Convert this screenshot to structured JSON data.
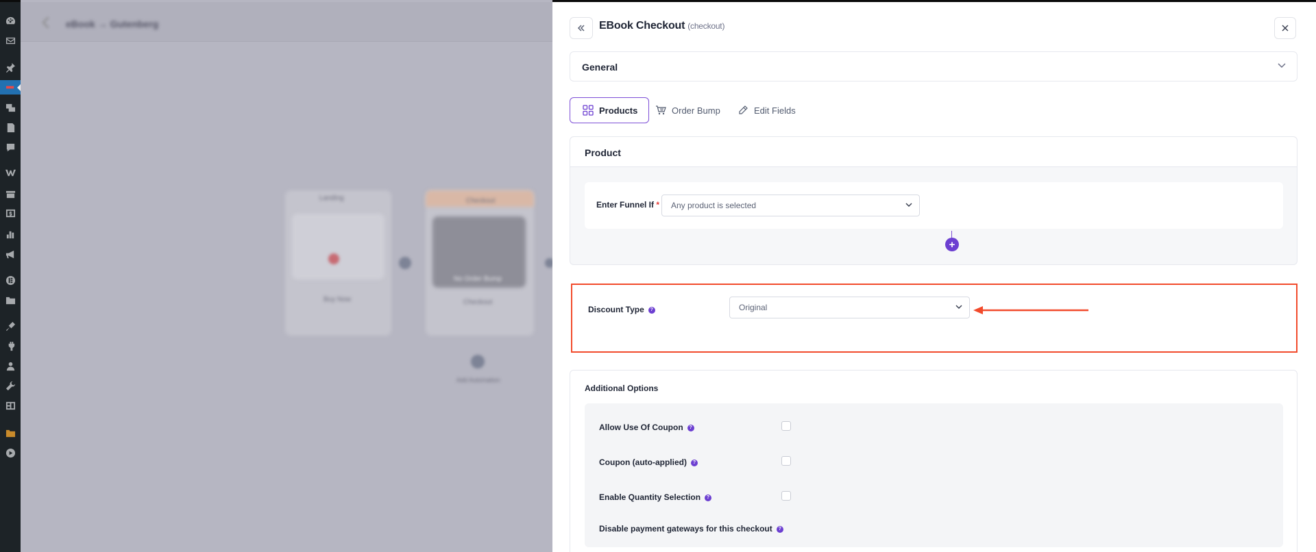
{
  "canvas": {
    "breadcrumb": "eBook → Gutenberg",
    "nodes": [
      {
        "label": "Landing",
        "caption": "Buy Now"
      },
      {
        "label": "Checkout",
        "caption": "Checkout",
        "banner": "No Order Bump"
      }
    ],
    "bottom_node_caption": "Add Automation"
  },
  "drawer": {
    "title": "EBook Checkout",
    "subtitle": "(checkout)",
    "general_label": "General",
    "tabs": [
      {
        "label": "Products",
        "icon": "grid-icon",
        "active": true
      },
      {
        "label": "Order Bump",
        "icon": "cart-icon",
        "active": false
      },
      {
        "label": "Edit Fields",
        "icon": "pencil-icon",
        "active": false
      }
    ],
    "product": {
      "heading": "Product",
      "enter_funnel_label": "Enter Funnel If",
      "required_mark": "*",
      "condition_value": "Any product is selected",
      "add_glyph": "+"
    },
    "discount": {
      "label": "Discount Type",
      "value": "Original"
    },
    "additional": {
      "heading": "Additional Options",
      "options": [
        {
          "label": "Allow Use Of Coupon",
          "checked": false
        },
        {
          "label": "Coupon (auto-applied)",
          "checked": false
        },
        {
          "label": "Enable Quantity Selection",
          "checked": false
        },
        {
          "label": "Disable payment gateways for this checkout"
        }
      ]
    },
    "help_glyph": "?"
  },
  "colors": {
    "accent": "#6c3fd1",
    "highlight": "#f24a2b",
    "wp_sidebar": "#1d2327",
    "wp_active": "#2271b1"
  },
  "sidebar_icons": [
    "dashboard-icon",
    "mail-icon",
    "pin-icon",
    "funnel-icon",
    "media-icon",
    "pages-icon",
    "comments-icon",
    "woo-icon",
    "products-icon",
    "payments-icon",
    "analytics-icon",
    "marketing-icon",
    "elementor-icon",
    "templates-icon",
    "appearance-icon",
    "plugins-icon",
    "users-icon",
    "tools-icon",
    "settings-icon",
    "folder-icon",
    "play-icon"
  ]
}
